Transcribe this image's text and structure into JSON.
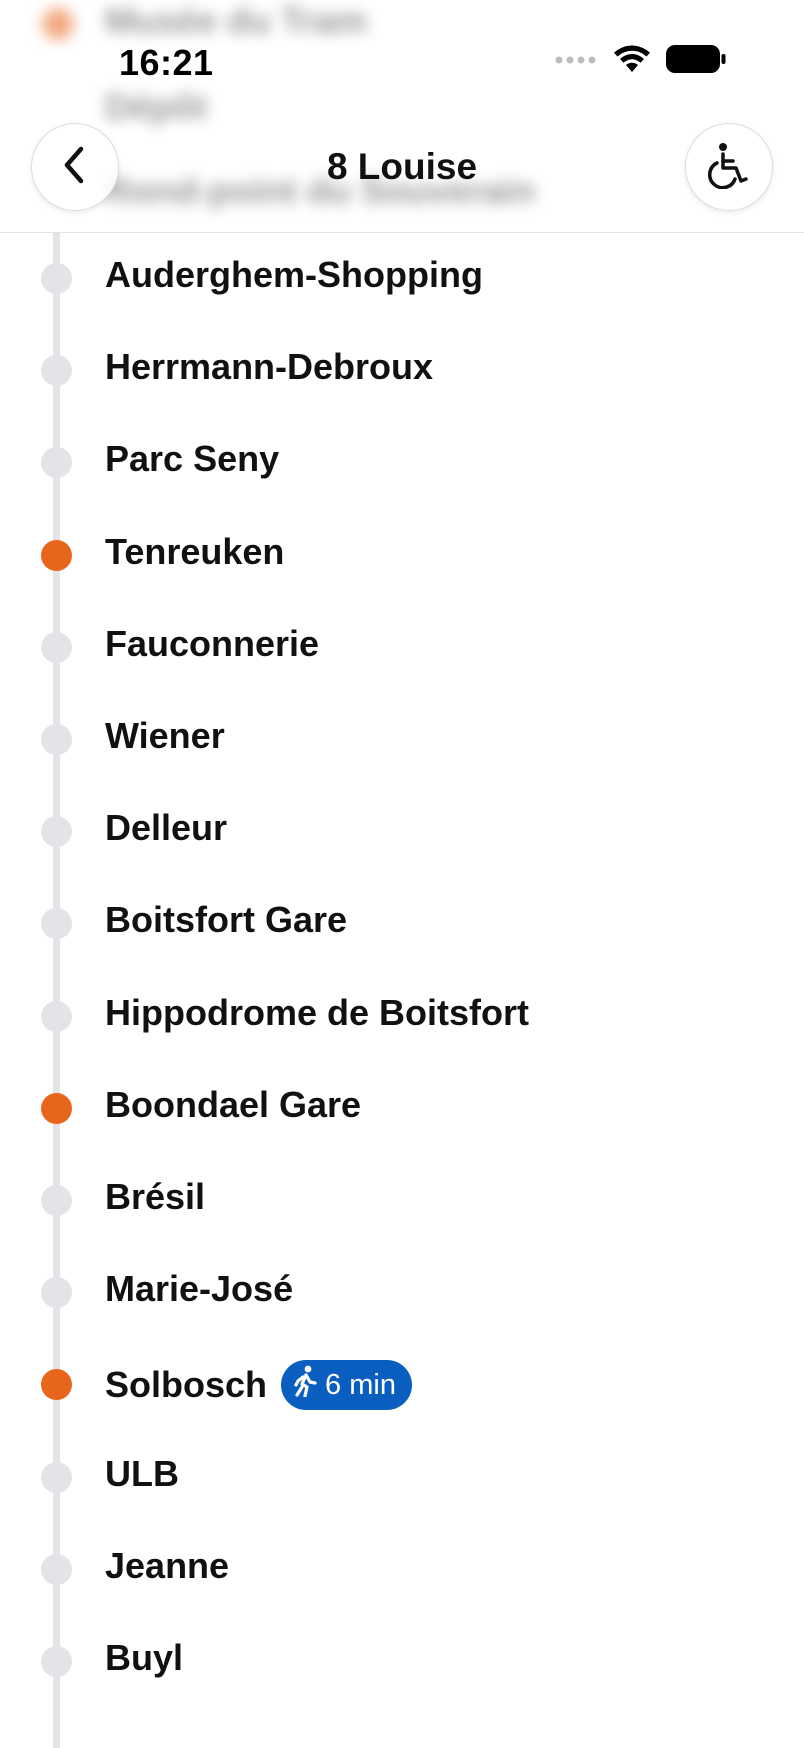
{
  "status_bar": {
    "time": "16:21"
  },
  "behind_header_stops": [
    "Musée du Tram",
    "Dépôt",
    "Rond-point du Souverain"
  ],
  "header": {
    "title": "8 Louise",
    "back_icon": "chevron-left-icon",
    "accessibility_icon": "wheelchair-icon"
  },
  "stops": [
    {
      "name": "Auderghem-Shopping",
      "active": false
    },
    {
      "name": "Herrmann-Debroux",
      "active": false
    },
    {
      "name": "Parc Seny",
      "active": false
    },
    {
      "name": "Tenreuken",
      "active": true
    },
    {
      "name": "Fauconnerie",
      "active": false
    },
    {
      "name": "Wiener",
      "active": false
    },
    {
      "name": "Delleur",
      "active": false
    },
    {
      "name": "Boitsfort Gare",
      "active": false
    },
    {
      "name": "Hippodrome de Boitsfort",
      "active": false
    },
    {
      "name": "Boondael Gare",
      "active": true
    },
    {
      "name": "Brésil",
      "active": false
    },
    {
      "name": "Marie-José",
      "active": false
    },
    {
      "name": "Solbosch",
      "active": true,
      "walk": "6 min"
    },
    {
      "name": "ULB",
      "active": false
    },
    {
      "name": "Jeanne",
      "active": false
    },
    {
      "name": "Buyl",
      "active": false
    }
  ],
  "colors": {
    "active_stop": "#e8651c",
    "inactive_stop": "#e3e3e8",
    "walk_badge": "#0a5ebf"
  }
}
